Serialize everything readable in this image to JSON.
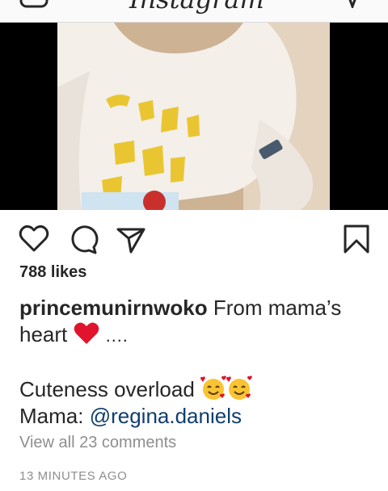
{
  "header": {
    "brand": "Instagram",
    "camera_icon": "camera-icon",
    "direct_icon": "paper-plane-icon"
  },
  "post": {
    "image": "photo of child in white sweater with yellow print",
    "actions": {
      "like_icon": "heart-icon",
      "comment_icon": "comment-bubble-icon",
      "share_icon": "paper-plane-icon",
      "save_icon": "bookmark-icon"
    },
    "likes": "788 likes",
    "caption": {
      "username": "princemunirnwoko",
      "text_1": "From mama’s",
      "text_2": "heart",
      "text_2_suffix": "….",
      "line_3": "Cuteness overload",
      "mama_prefix": "Mama:",
      "mention": "@regina.daniels"
    },
    "view_comments": "View all 23 comments",
    "timestamp": "13 MINUTES AGO"
  },
  "colors": {
    "text": "#262626",
    "muted": "#8e8e8e",
    "mention": "#0f3e6e",
    "heart": "#e0142c"
  }
}
